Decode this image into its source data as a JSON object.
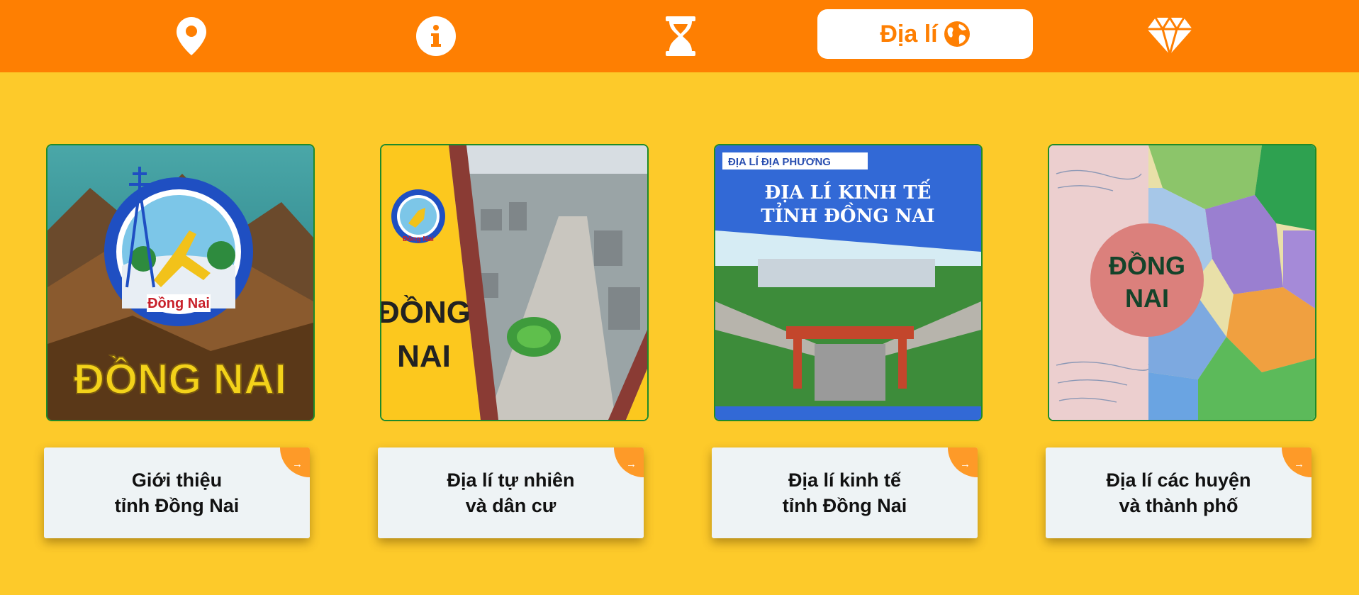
{
  "nav": {
    "items": [
      {
        "icon": "map-pin-icon"
      },
      {
        "icon": "info-icon"
      },
      {
        "icon": "hourglass-icon"
      },
      {
        "icon": "globe-icon",
        "label": "Địa lí",
        "active": true
      },
      {
        "icon": "diamond-icon"
      }
    ]
  },
  "cards": [
    {
      "image_text": {
        "logo": "Đồng Nai",
        "title": "ĐỒNG NAI"
      },
      "label_line1": "Giới thiệu",
      "label_line2": "tỉnh Đồng Nai",
      "arrow": "→"
    },
    {
      "image_text": {
        "logo": "Đồng Nai",
        "title_line1": "ĐỒNG",
        "title_line2": "NAI"
      },
      "label_line1": "Địa lí tự nhiên",
      "label_line2": "và dân cư",
      "arrow": "→"
    },
    {
      "image_text": {
        "tag": "ĐỊA LÍ ĐỊA PHƯƠNG",
        "title_line1": "ĐỊA LÍ KINH TẾ",
        "title_line2": "TỈNH ĐỒNG NAI"
      },
      "label_line1": "Địa lí kinh tế",
      "label_line2": "tỉnh Đồng Nai",
      "arrow": "→"
    },
    {
      "image_text": {
        "title_line1": "ĐỒNG",
        "title_line2": "NAI"
      },
      "label_line1": "Địa lí các huyện",
      "label_line2": "và thành phố",
      "arrow": "→"
    }
  ],
  "colors": {
    "topbar": "#fe7f02",
    "background": "#fdca2a",
    "card_label_bg": "#eef3f5",
    "corner": "#fe9a28"
  }
}
